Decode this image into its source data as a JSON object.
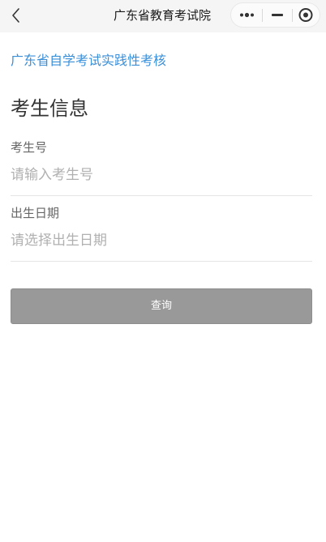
{
  "navbar": {
    "title": "广东省教育考试院",
    "back_icon": "chevron-left-icon",
    "capsule": {
      "more_icon": "more-dots-icon",
      "minimize_icon": "minimize-icon",
      "close_icon": "target-close-icon"
    }
  },
  "page": {
    "org_link": "广东省自学考试实践性考核",
    "section_heading": "考生信息"
  },
  "form": {
    "exam_number": {
      "label": "考生号",
      "value": "",
      "placeholder": "请输入考生号"
    },
    "birth_date": {
      "label": "出生日期",
      "value": "",
      "placeholder": "请选择出生日期"
    },
    "submit_label": "查询"
  },
  "colors": {
    "link": "#3a8fd9",
    "button_bg": "#999999",
    "navbar_bg": "#f5f5f5"
  }
}
